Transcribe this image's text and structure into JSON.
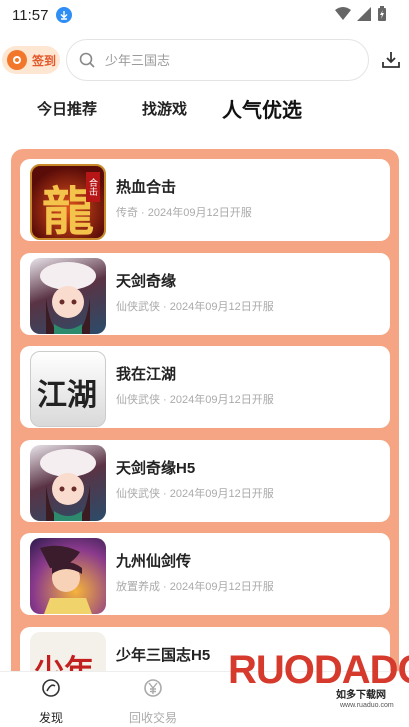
{
  "status": {
    "time": "11:57"
  },
  "header": {
    "checkin_label": "签到",
    "search_placeholder": "少年三国志"
  },
  "tabs": [
    {
      "label": "今日推荐"
    },
    {
      "label": "找游戏"
    },
    {
      "label": "人气优选"
    }
  ],
  "games": [
    {
      "name": "热血合击",
      "meta": "传奇 · 2024年09月12日开服",
      "icon_text": "龍"
    },
    {
      "name": "天剑奇缘",
      "meta": "仙侠武侠 · 2024年09月12日开服"
    },
    {
      "name": "我在江湖",
      "meta": "仙侠武侠 · 2024年09月12日开服",
      "icon_text": "江湖"
    },
    {
      "name": "天剑奇缘H5",
      "meta": "仙侠武侠 · 2024年09月12日开服"
    },
    {
      "name": "九州仙剑传",
      "meta": "放置养成 · 2024年09月12日开服"
    },
    {
      "name": "少年三国志H5",
      "meta": "",
      "icon_text": "少年"
    }
  ],
  "bottom_nav": [
    {
      "label": "发现",
      "active": true
    },
    {
      "label": "回收交易",
      "active": false
    }
  ],
  "watermark": {
    "logo": "RUODADO",
    "text": "如多下载网",
    "url": "www.ruaduo.com"
  },
  "colors": {
    "accent": "#f5a584",
    "checkin": "#f2772b"
  }
}
